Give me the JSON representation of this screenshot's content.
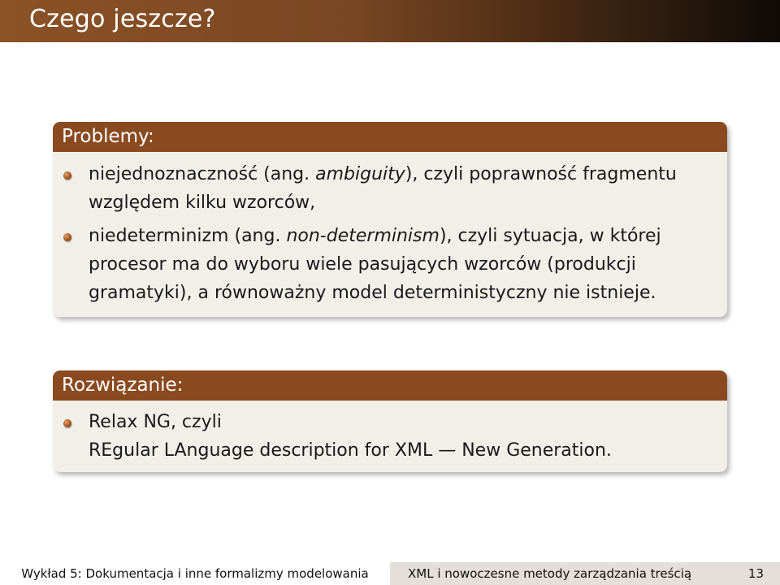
{
  "slide": {
    "title": "Czego jeszcze?"
  },
  "problems": {
    "heading": "Problemy:",
    "items": [
      {
        "before": "niejednoznaczność (ang. ",
        "emph": "ambiguity",
        "after": "), czyli poprawność fragmentu względem kilku wzorców,"
      },
      {
        "before": "niedeterminizm (ang. ",
        "emph": "non-determinism",
        "after": "), czyli sytuacja, w której procesor ma do wyboru wiele pasujących wzorców (produkcji gramatyki), a równoważny model deterministyczny nie istnieje."
      }
    ]
  },
  "solution": {
    "heading": "Rozwiązanie:",
    "items": [
      {
        "line1": "Relax NG, czyli",
        "line2": "REgular LAnguage description for XML — New Generation."
      }
    ]
  },
  "footer": {
    "lecture": "Wykład 5: Dokumentacja i inne formalizmy modelowania",
    "course": "XML i nowoczesne metody zarządzania treścią",
    "page": "13"
  },
  "colors": {
    "accent": "#8a4a20",
    "block_background": "#f2efe9",
    "footer_right_background": "#e4dfd8"
  }
}
